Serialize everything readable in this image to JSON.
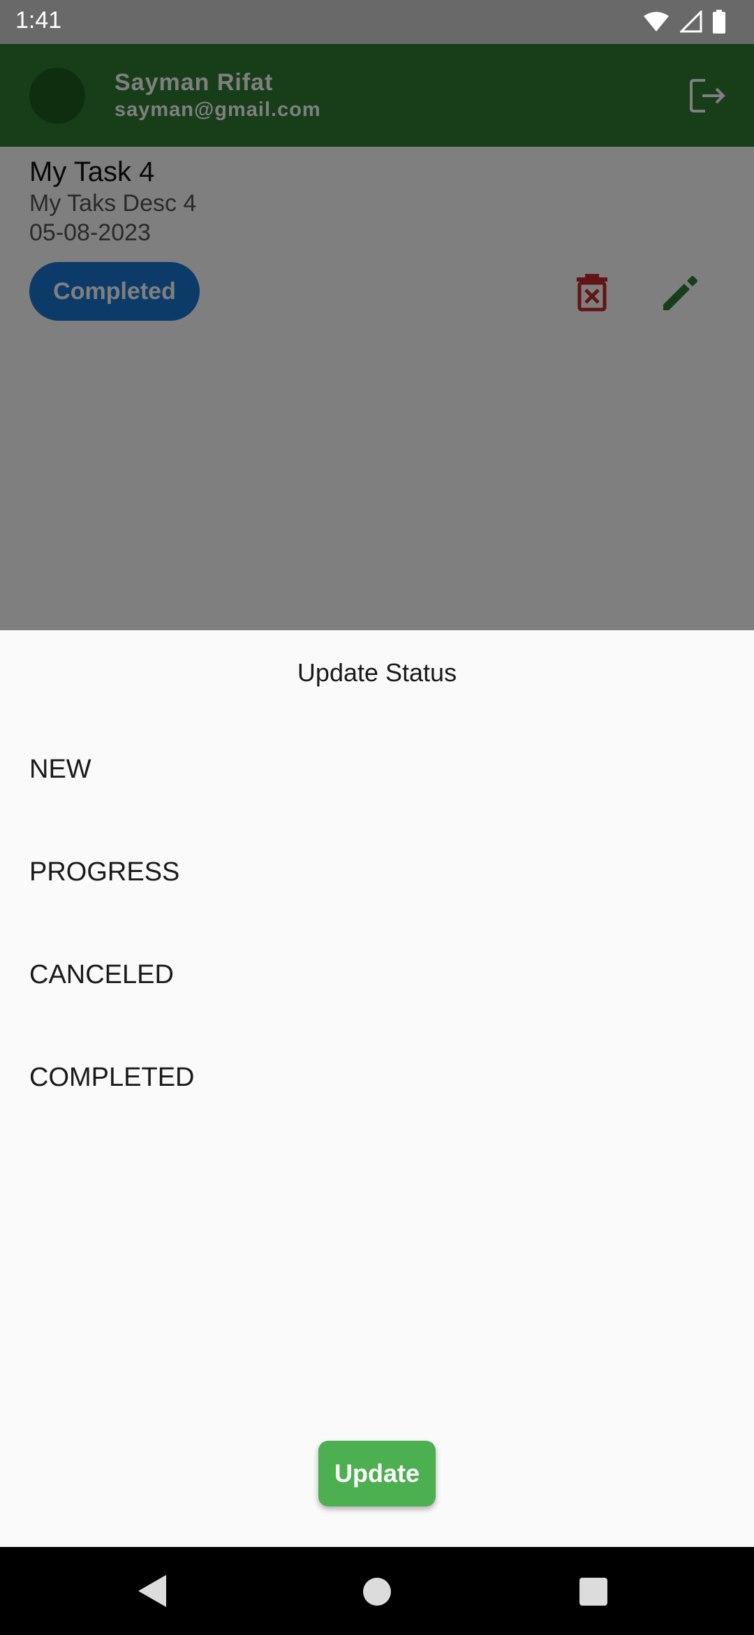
{
  "status_bar": {
    "time": "1:41"
  },
  "app_bar": {
    "user_name": "Sayman Rifat",
    "user_email": "sayman@gmail.com"
  },
  "task": {
    "title": "My Task 4",
    "description": "My Taks Desc 4",
    "date": "05-08-2023",
    "status": "Completed"
  },
  "sheet": {
    "title": "Update Status",
    "options": [
      "NEW",
      "PROGRESS",
      "CANCELED",
      "COMPLETED"
    ],
    "update_label": "Update"
  },
  "colors": {
    "app_bar": "#2e7d32",
    "chip": "#1976d2",
    "delete_icon": "#c62828",
    "edit_icon": "#2e7d32",
    "update_button": "#4caf50"
  }
}
